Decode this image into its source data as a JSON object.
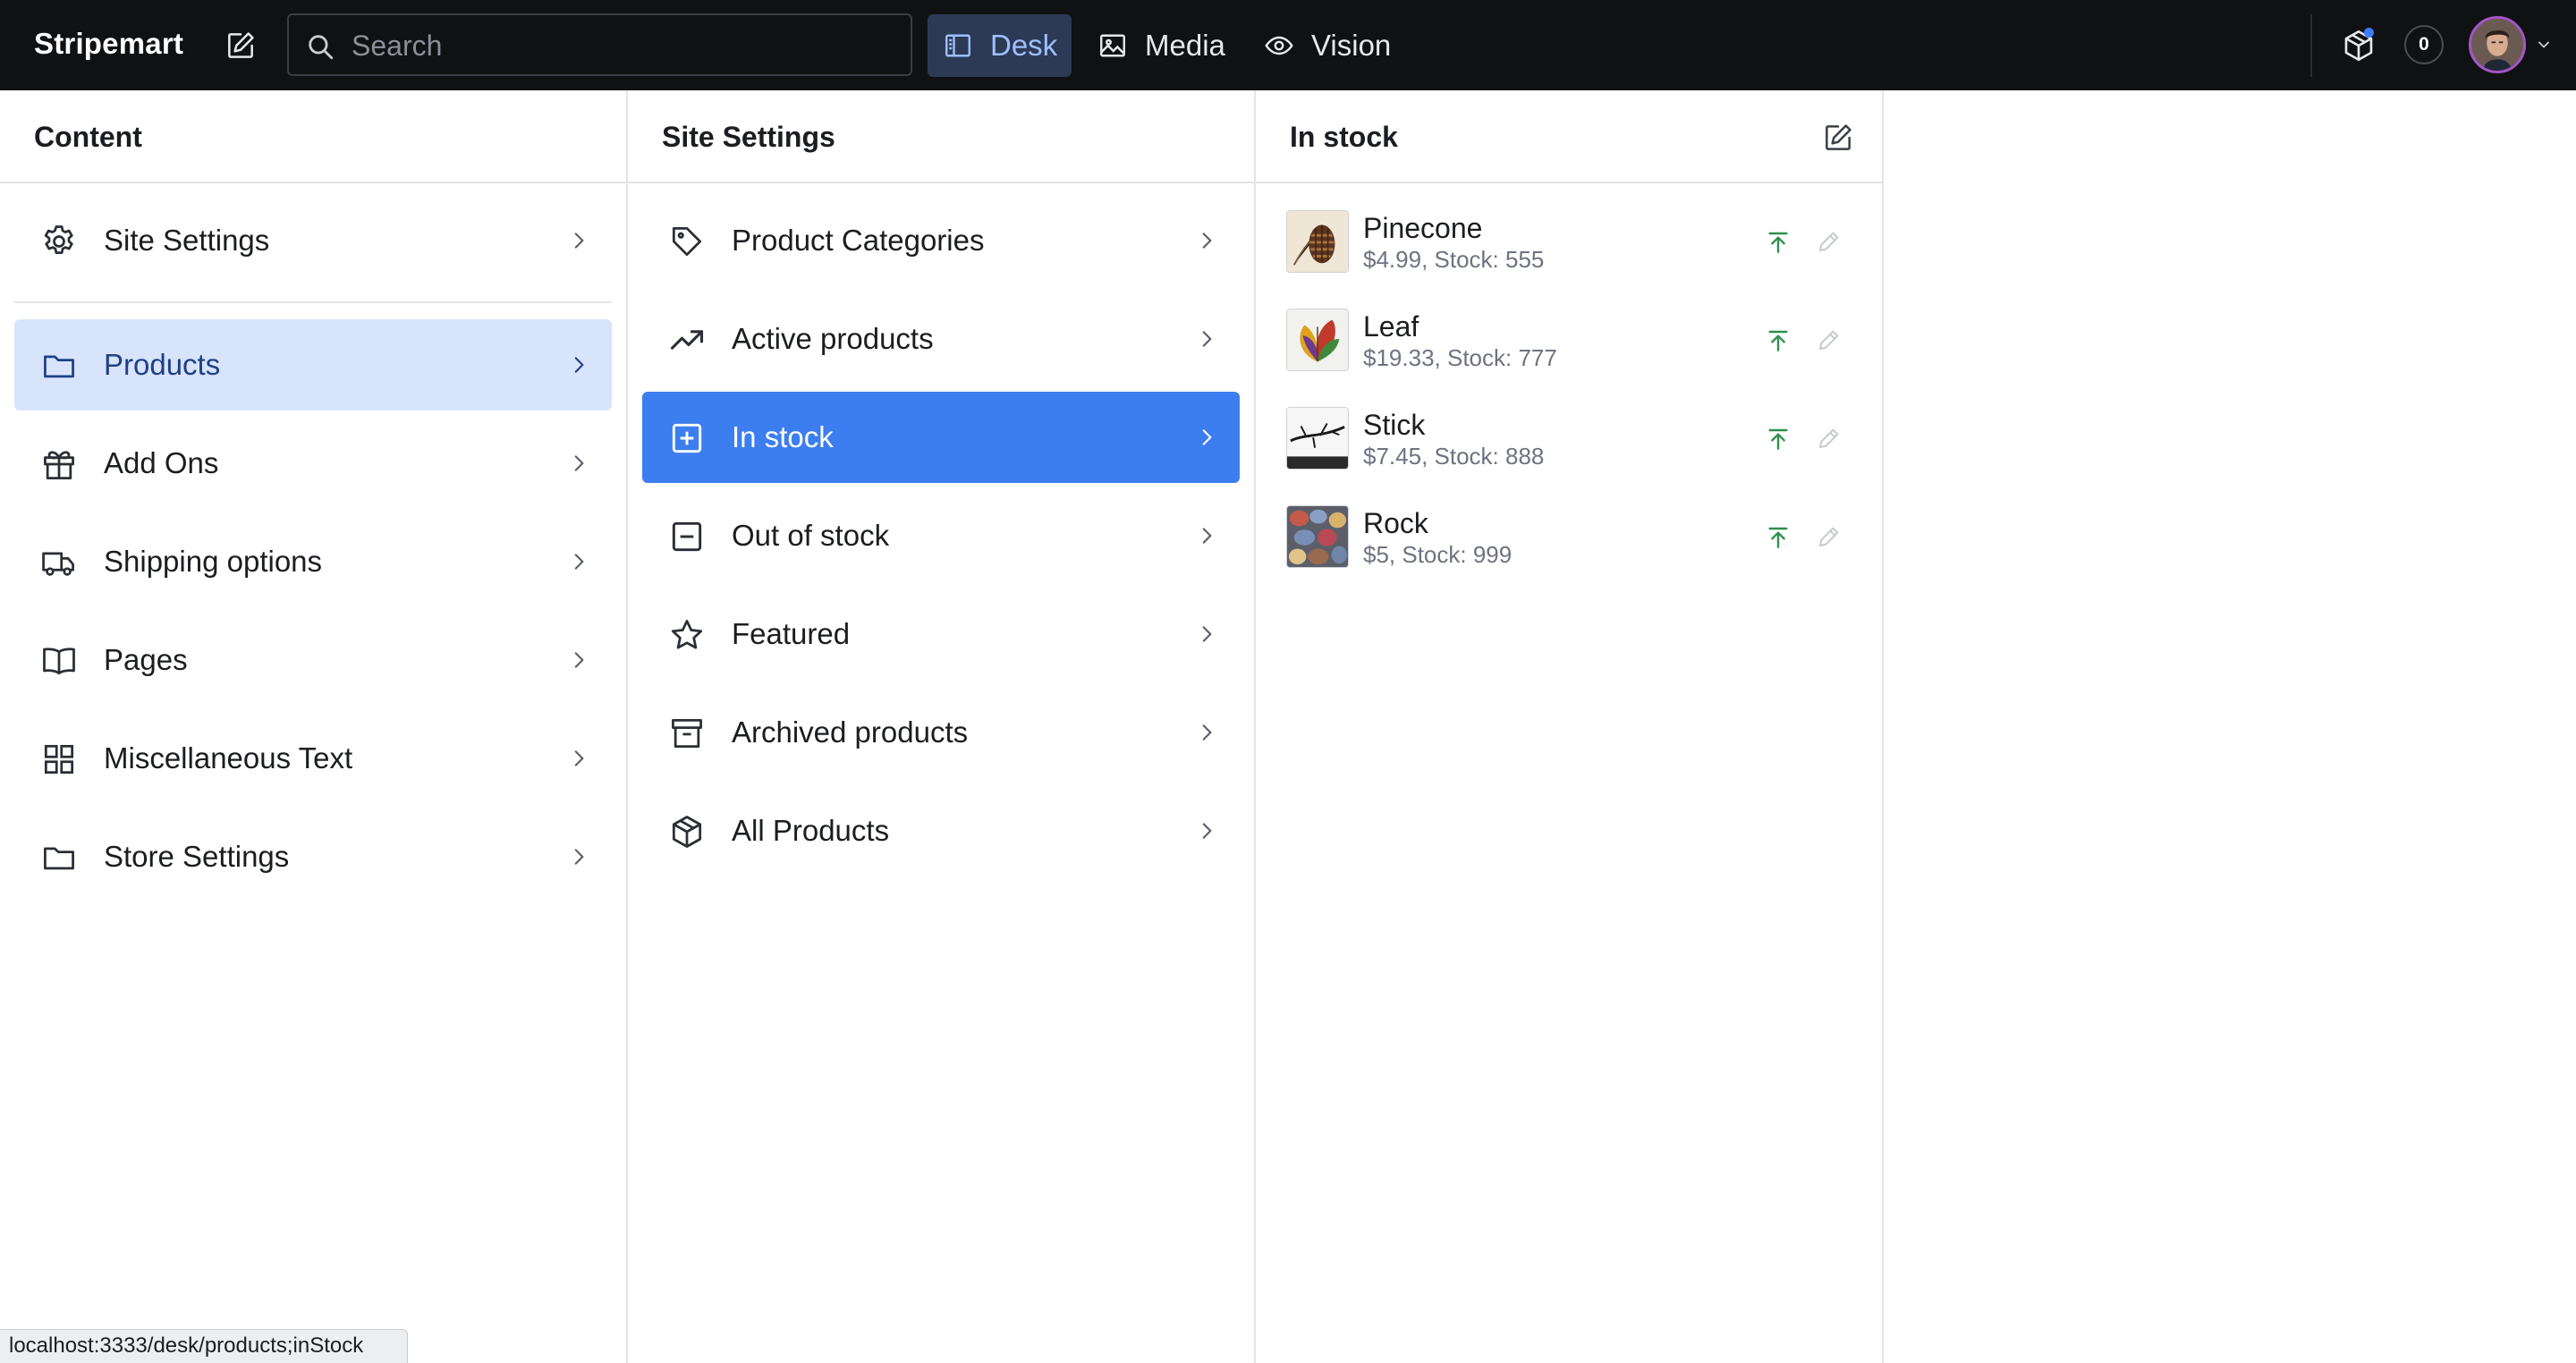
{
  "app": {
    "brand": "Stripemart",
    "search_placeholder": "Search",
    "tools": [
      {
        "label": "Desk",
        "icon": "desk-icon",
        "active": true
      },
      {
        "label": "Media",
        "icon": "image-icon",
        "active": false
      },
      {
        "label": "Vision",
        "icon": "eye-icon",
        "active": false
      }
    ],
    "presence_count": "0",
    "accent_color": "#3c7ef0"
  },
  "content_pane": {
    "title": "Content",
    "items": [
      {
        "label": "Site Settings",
        "icon": "gear-icon"
      },
      {
        "label": "Products",
        "icon": "folder-icon",
        "selected": true
      },
      {
        "label": "Add Ons",
        "icon": "gift-icon"
      },
      {
        "label": "Shipping options",
        "icon": "truck-icon"
      },
      {
        "label": "Pages",
        "icon": "book-icon"
      },
      {
        "label": "Miscellaneous Text",
        "icon": "grid-icon"
      },
      {
        "label": "Store Settings",
        "icon": "folder-icon"
      }
    ]
  },
  "settings_pane": {
    "title": "Site Settings",
    "items": [
      {
        "label": "Product Categories",
        "icon": "tag-icon"
      },
      {
        "label": "Active products",
        "icon": "trend-up-icon"
      },
      {
        "label": "In stock",
        "icon": "add-square-icon",
        "selected": true
      },
      {
        "label": "Out of stock",
        "icon": "remove-square-icon"
      },
      {
        "label": "Featured",
        "icon": "star-icon"
      },
      {
        "label": "Archived products",
        "icon": "archive-icon"
      },
      {
        "label": "All Products",
        "icon": "package-icon"
      }
    ]
  },
  "stock_pane": {
    "title": "In stock",
    "documents": [
      {
        "title": "Pinecone",
        "subtitle": "$4.99, Stock: 555"
      },
      {
        "title": "Leaf",
        "subtitle": "$19.33, Stock: 777"
      },
      {
        "title": "Stick",
        "subtitle": "$7.45, Stock: 888"
      },
      {
        "title": "Rock",
        "subtitle": "$5, Stock: 999"
      }
    ]
  },
  "status_bar": {
    "url": "localhost:3333/desk/products;inStock"
  }
}
